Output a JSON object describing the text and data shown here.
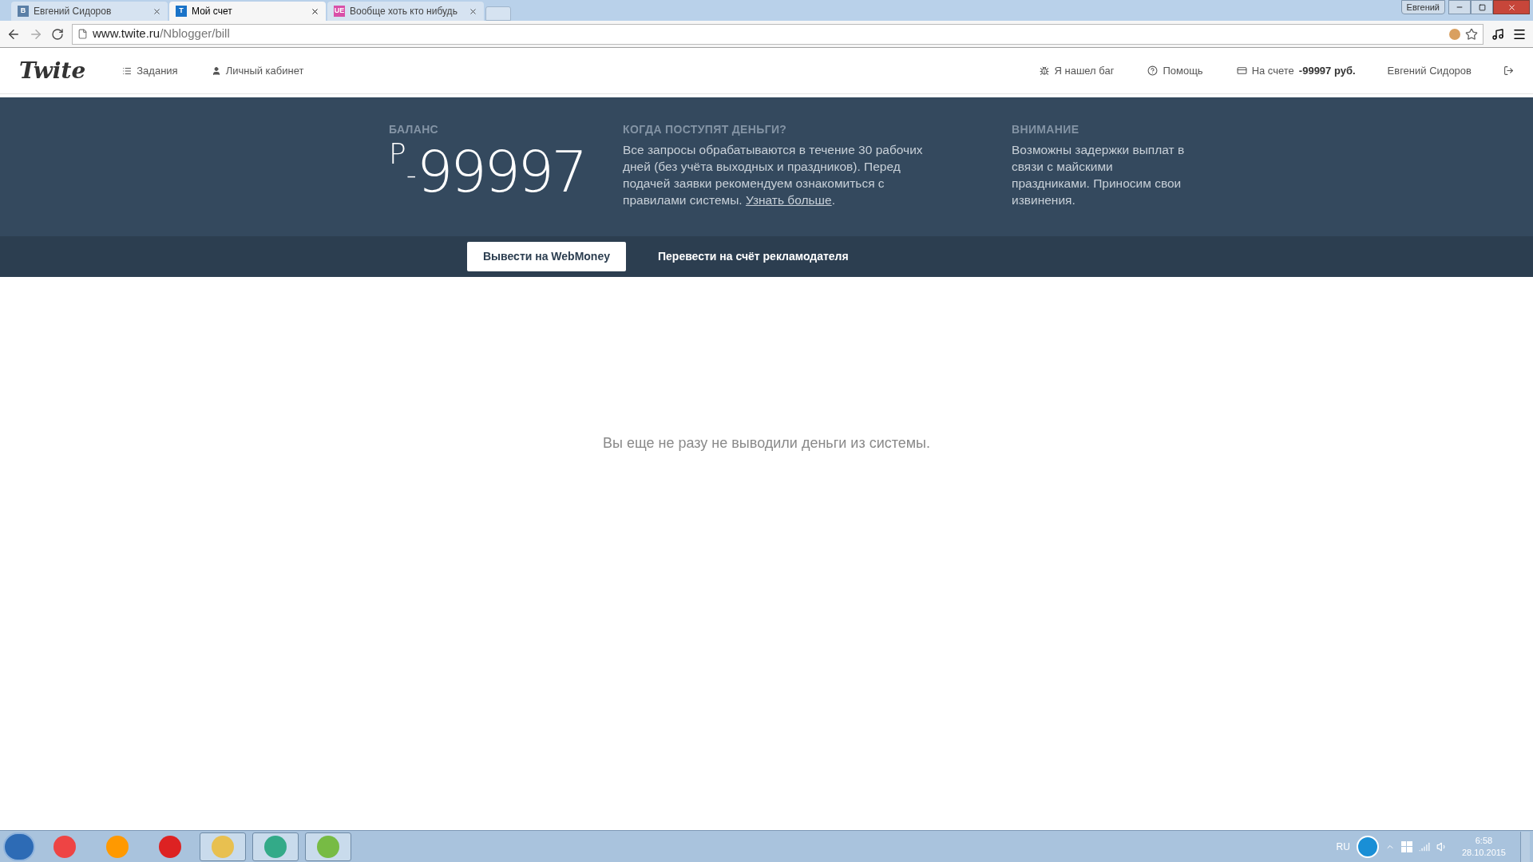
{
  "browser": {
    "tabs": [
      {
        "favicon": "В",
        "title": "Евгений Сидоров",
        "selected": false,
        "color": "#5b7fa6"
      },
      {
        "favicon": "T",
        "title": "Мой счет",
        "selected": true,
        "color": "#1a73c8"
      },
      {
        "favicon": "UE",
        "title": "Вообще хоть кто нибудь",
        "selected": false,
        "color": "#d94fa8"
      }
    ],
    "profile": "Евгений",
    "url_host": "www.twite.ru",
    "url_path": "/Nblogger/bill"
  },
  "site": {
    "logo": "Twite",
    "nav_left": [
      {
        "kind": "list",
        "label": "Задания"
      },
      {
        "kind": "user",
        "label": "Личный кабинет"
      }
    ],
    "nav_right": [
      {
        "kind": "bug",
        "label": "Я нашел баг"
      },
      {
        "kind": "help",
        "label": "Помощь"
      }
    ],
    "account_label": "На счете",
    "account_amount": "-99997 руб.",
    "user_name": "Евгений Сидоров"
  },
  "balance": {
    "heading": "БАЛАНС",
    "currency": "Р",
    "sign": "-",
    "amount": "99997"
  },
  "when": {
    "heading": "КОГДА ПОСТУПЯТ ДЕНЬГИ?",
    "text": "Все запросы обрабатываются в течение 30 рабочих дней (без учёта выходных и праздников). Перед подачей заявки рекомендуем ознакомиться с правилами системы. ",
    "link": "Узнать больше",
    "after": "."
  },
  "notice": {
    "heading": "ВНИМАНИЕ",
    "text": "Возможны задержки выплат в связи с майскими праздниками. Приносим свои извинения."
  },
  "actions": [
    {
      "label": "Вывести на WebMoney",
      "selected": true
    },
    {
      "label": "Перевести на счёт рекламодателя",
      "selected": false
    }
  ],
  "empty_message": "Вы еще не разу не выводили деньги из системы.",
  "taskbar": {
    "language": "RU",
    "time": "6:58",
    "date": "28.10.2015"
  }
}
